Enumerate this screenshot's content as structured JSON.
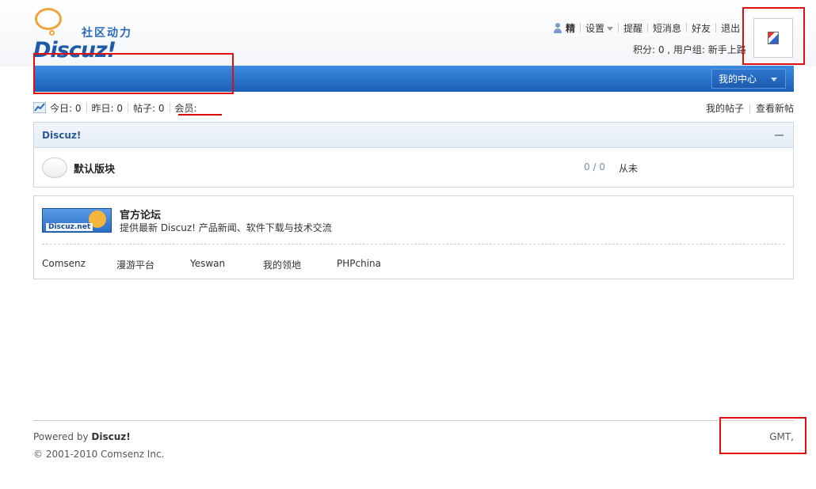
{
  "logo": {
    "subtitle": "社区动力",
    "wordmark": "Discuz!"
  },
  "topnav": {
    "username": "精",
    "settings": "设置",
    "remind": "提醒",
    "messages": "短消息",
    "friends": "好友",
    "logout": "退出",
    "credits": "积分: 0 , 用户组: 新手上路"
  },
  "navbar": {
    "my_center": "我的中心"
  },
  "stats": {
    "today": "今日: 0",
    "yesterday": "昨日: 0",
    "posts": "帖子: 0",
    "members": "会员:"
  },
  "quicklinks": {
    "my_posts": "我的帖子",
    "new_posts": "查看新帖"
  },
  "forum_group": {
    "title": "Discuz!",
    "forums": [
      {
        "name": "默认版块",
        "count": "0 / 0",
        "last": "从未"
      }
    ]
  },
  "links": {
    "official_logo_text": "Discuz.net",
    "official_title": "官方论坛",
    "official_desc": "提供最新 Discuz! 产品新闻、软件下载与技术交流",
    "items": [
      "Comsenz",
      "漫游平台",
      "Yeswan",
      "我的领地",
      "PHPchina"
    ]
  },
  "footer": {
    "powered_prefix": "Powered by ",
    "powered_brand": "Discuz!",
    "copyright": "© 2001-2010 Comsenz Inc.",
    "timezone": "GMT,"
  },
  "colors": {
    "accent": "#1a5fb8",
    "highlight": "#e01010"
  }
}
